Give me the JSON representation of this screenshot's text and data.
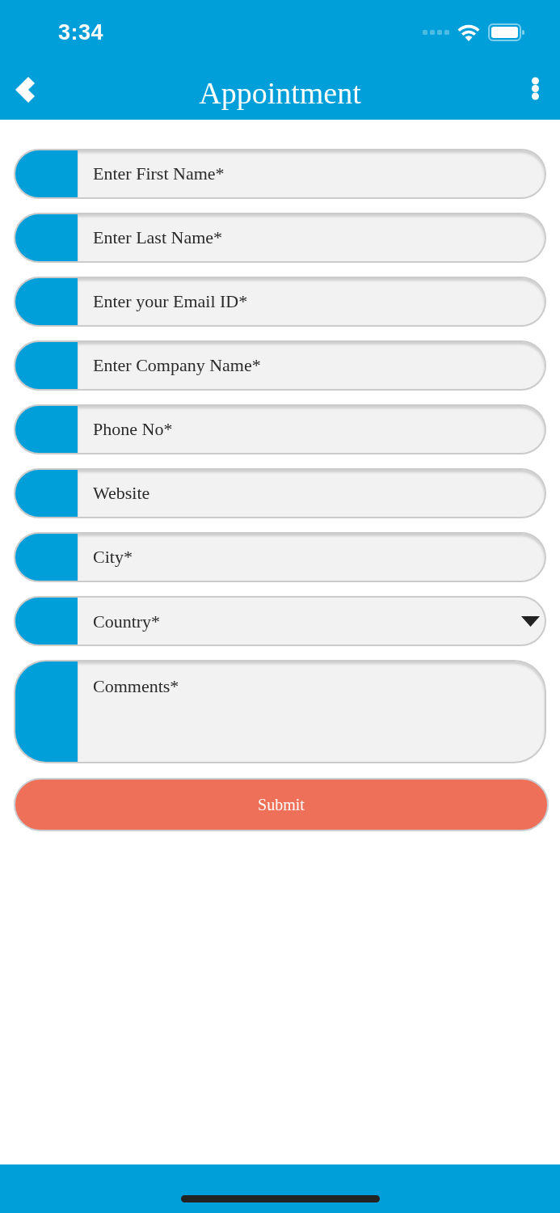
{
  "status_bar": {
    "time": "3:34"
  },
  "nav_bar": {
    "title": "Appointment"
  },
  "form": {
    "fields": [
      {
        "kind": "text",
        "placeholder": "Enter First Name*"
      },
      {
        "kind": "text",
        "placeholder": "Enter Last Name*"
      },
      {
        "kind": "text",
        "placeholder": "Enter your Email ID*"
      },
      {
        "kind": "text",
        "placeholder": "Enter Company Name*"
      },
      {
        "kind": "text",
        "placeholder": "Phone No*"
      },
      {
        "kind": "text",
        "placeholder": "Website"
      },
      {
        "kind": "text",
        "placeholder": "City*"
      },
      {
        "kind": "select",
        "placeholder": "Country*"
      },
      {
        "kind": "textarea",
        "placeholder": "Comments*"
      }
    ]
  },
  "submit_button": {
    "label": "Submit"
  }
}
